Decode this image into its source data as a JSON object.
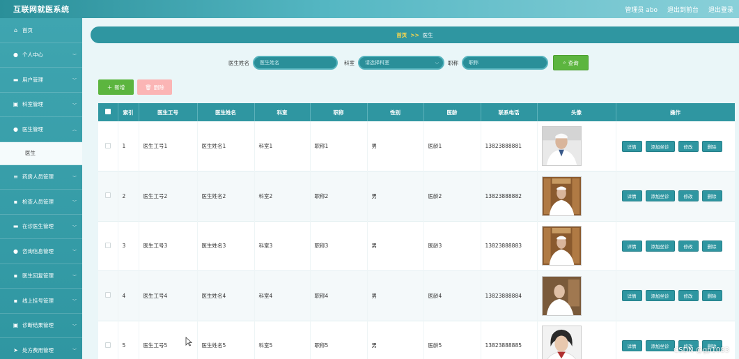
{
  "app": {
    "title": "互联网就医系统"
  },
  "top_right": {
    "admin": "管理员 abo",
    "exit_frontend": "退出到前台",
    "logout": "退出登录"
  },
  "sidebar": {
    "items": [
      {
        "label": "首页",
        "icon": "home-icon",
        "glyph": "⌂"
      },
      {
        "label": "个人中心",
        "icon": "user-icon",
        "glyph": "●"
      },
      {
        "label": "用户管理",
        "icon": "card-icon",
        "glyph": "▬"
      },
      {
        "label": "科室管理",
        "icon": "building-icon",
        "glyph": "▣"
      },
      {
        "label": "医生管理",
        "icon": "user-icon",
        "glyph": "●"
      }
    ],
    "sub_item": "医生",
    "items_after": [
      {
        "label": "药房人员管理",
        "icon": "list-icon",
        "glyph": "≡"
      },
      {
        "label": "检查人员管理",
        "icon": "grid-icon",
        "glyph": "▪"
      },
      {
        "label": "在诊医生管理",
        "icon": "card-icon",
        "glyph": "▬"
      },
      {
        "label": "咨询信息管理",
        "icon": "user-icon",
        "glyph": "●"
      },
      {
        "label": "医生回复管理",
        "icon": "grid-icon",
        "glyph": "▪"
      },
      {
        "label": "线上挂号管理",
        "icon": "grid-icon",
        "glyph": "▪"
      },
      {
        "label": "诊断结果管理",
        "icon": "image-icon",
        "glyph": "▣"
      },
      {
        "label": "处方费用管理",
        "icon": "send-icon",
        "glyph": "➤"
      }
    ]
  },
  "breadcrumb": {
    "home": "首页",
    "sep": ">>",
    "current": "医生"
  },
  "search": {
    "name_label": "医生姓名",
    "name_placeholder": "医生姓名",
    "dept_label": "科室",
    "dept_placeholder": "请选择科室",
    "title_label": "职称",
    "title_placeholder": "职称",
    "search_btn": "查询"
  },
  "actions": {
    "add": "新增",
    "delete": "删除"
  },
  "table": {
    "headers": [
      "索引",
      "医生工号",
      "医生姓名",
      "科室",
      "职称",
      "性别",
      "医龄",
      "联系电话",
      "头像",
      "操作"
    ],
    "rows": [
      {
        "idx": "1",
        "no": "医生工号1",
        "name": "医生姓名1",
        "dept": "科室1",
        "title": "职称1",
        "sex": "男",
        "years": "医龄1",
        "phone": "13823888881"
      },
      {
        "idx": "2",
        "no": "医生工号2",
        "name": "医生姓名2",
        "dept": "科室2",
        "title": "职称2",
        "sex": "男",
        "years": "医龄2",
        "phone": "13823888882"
      },
      {
        "idx": "3",
        "no": "医生工号3",
        "name": "医生姓名3",
        "dept": "科室3",
        "title": "职称3",
        "sex": "男",
        "years": "医龄3",
        "phone": "13823888883"
      },
      {
        "idx": "4",
        "no": "医生工号4",
        "name": "医生姓名4",
        "dept": "科室4",
        "title": "职称4",
        "sex": "男",
        "years": "医龄4",
        "phone": "13823888884"
      },
      {
        "idx": "5",
        "no": "医生工号5",
        "name": "医生姓名5",
        "dept": "科室5",
        "title": "职称5",
        "sex": "男",
        "years": "医龄5",
        "phone": "13823888885"
      }
    ],
    "ops": [
      "详情",
      "添加坐诊",
      "修改",
      "删除"
    ]
  },
  "watermark": "CSDN @gp1083",
  "colors": {
    "primary": "#2f96a1",
    "green": "#5cb53f",
    "pink": "#fbb5b5",
    "accent": "#ffd84a"
  }
}
